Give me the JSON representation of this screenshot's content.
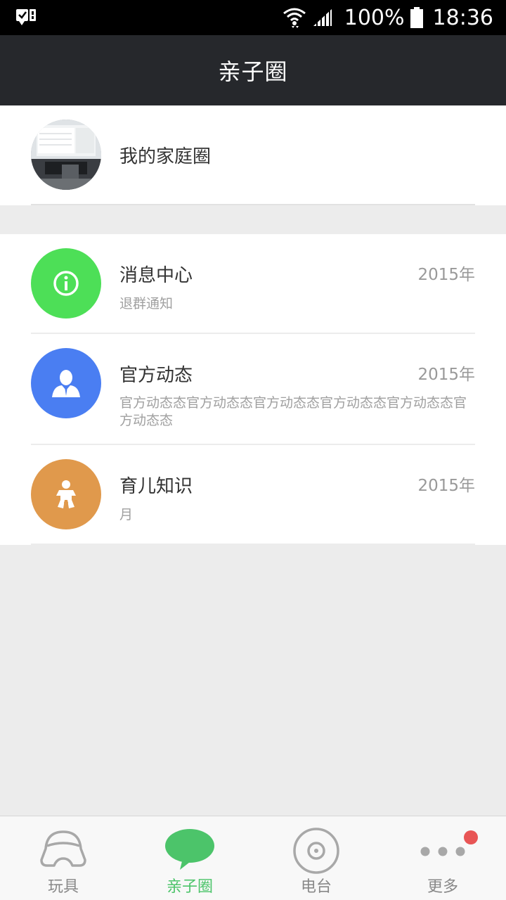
{
  "status_bar": {
    "battery": "100%",
    "time": "18:36",
    "icons": [
      "notification-check-icon",
      "wifi-icon",
      "signal-icon",
      "battery-icon"
    ]
  },
  "header": {
    "title": "亲子圈"
  },
  "family": {
    "name": "我的家庭圈"
  },
  "messages": [
    {
      "title": "消息中心",
      "date": "2015年",
      "subtitle": "退群通知",
      "icon": "info-icon",
      "color": "#4ddf57"
    },
    {
      "title": "官方动态",
      "date": "2015年",
      "subtitle": "官方动态态官方动态态官方动态态官方动态态官方动态态官方动态态",
      "icon": "person-icon",
      "color": "#4a7ef2"
    },
    {
      "title": "育儿知识",
      "date": "2015年",
      "subtitle": "月",
      "icon": "baby-icon",
      "color": "#e0994c"
    }
  ],
  "tabs": [
    {
      "label": "玩具",
      "icon": "toy-car-icon",
      "active": false
    },
    {
      "label": "亲子圈",
      "icon": "chat-bubble-icon",
      "active": true
    },
    {
      "label": "电台",
      "icon": "radio-disc-icon",
      "active": false
    },
    {
      "label": "更多",
      "icon": "more-dots-icon",
      "active": false
    }
  ],
  "colors": {
    "title_bar": "#26282c",
    "active_tab": "#4cc46a",
    "badge": "#e85555"
  }
}
